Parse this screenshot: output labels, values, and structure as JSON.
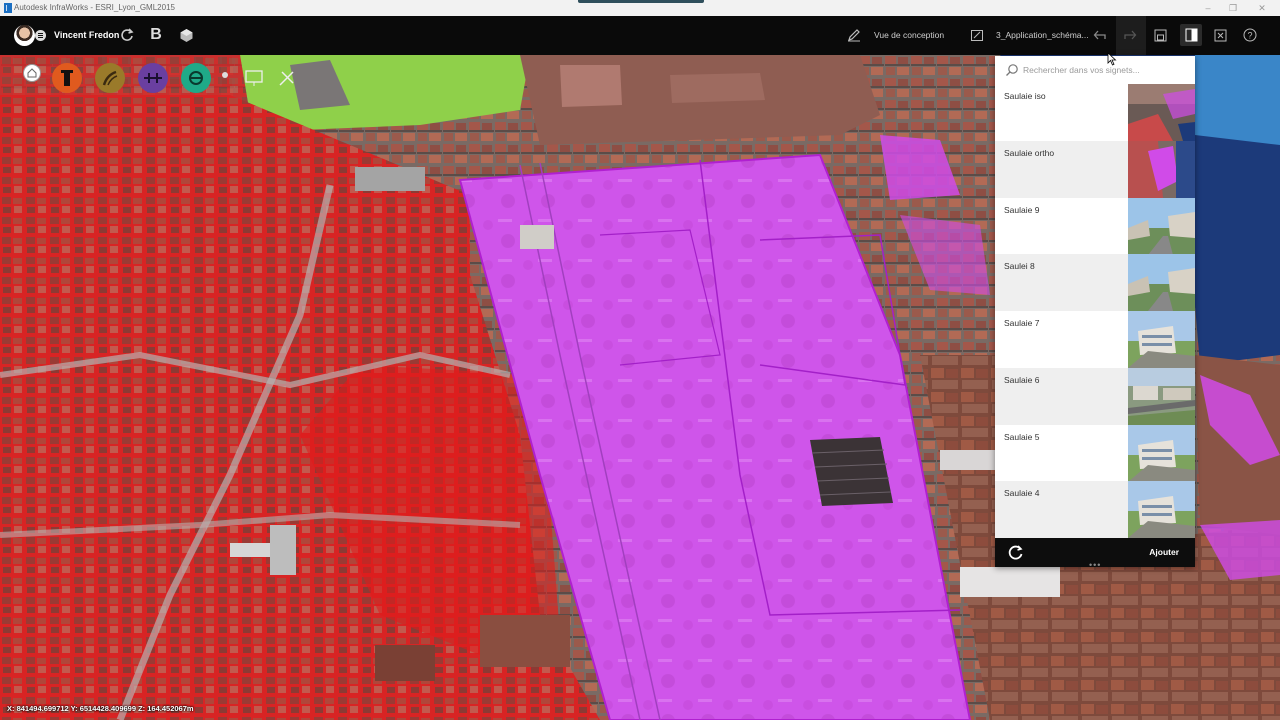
{
  "window": {
    "title": "Autodesk InfraWorks - ESRI_Lyon_GML2015",
    "controls": [
      "–",
      "❐",
      "✕"
    ]
  },
  "toolbar": {
    "user_name": "Vincent Fredon",
    "design_view_label": "Vue de conception",
    "scenario_label": "3_Application_schéma...",
    "icons": [
      "sync-icon",
      "bim-b-icon",
      "model-cube-icon",
      "pencil-icon",
      "scenario-icon",
      "undo-icon",
      "redo-icon",
      "save-icon",
      "bookmarks-icon",
      "fullscreen-icon",
      "help-icon"
    ]
  },
  "themes": {
    "buttons": [
      {
        "name": "home",
        "color": "#ffffff"
      },
      {
        "name": "build-manage",
        "color": "#e05a1e"
      },
      {
        "name": "roads",
        "color": "#9a7a2a"
      },
      {
        "name": "transport",
        "color": "#6a3fa0"
      },
      {
        "name": "water",
        "color": "#1faa88"
      }
    ]
  },
  "bookmarks": {
    "search_placeholder": "Rechercher dans vos signets...",
    "items": [
      {
        "label": "Saulaie iso",
        "thumb": "iso"
      },
      {
        "label": "Saulaie ortho",
        "thumb": "ortho"
      },
      {
        "label": "Saulaie 9",
        "thumb": "street"
      },
      {
        "label": "Saulei 8",
        "thumb": "street"
      },
      {
        "label": "Saulaie 7",
        "thumb": "building"
      },
      {
        "label": "Saulaie 6",
        "thumb": "aerial"
      },
      {
        "label": "Saulaie 5",
        "thumb": "building"
      },
      {
        "label": "Saulaie 4",
        "thumb": "building"
      }
    ],
    "add_label": "Ajouter",
    "grip": "•••"
  },
  "status": {
    "coordinates": "X: 841494.699712 Y: 6514428.409699 Z: 164.452067m"
  },
  "colors": {
    "red_zone": "#e21a1a",
    "magenta_zone": "#d04be8",
    "water": "#1c3a7a",
    "park": "#8fd04a",
    "panel_footer": "#0d0d0d"
  }
}
